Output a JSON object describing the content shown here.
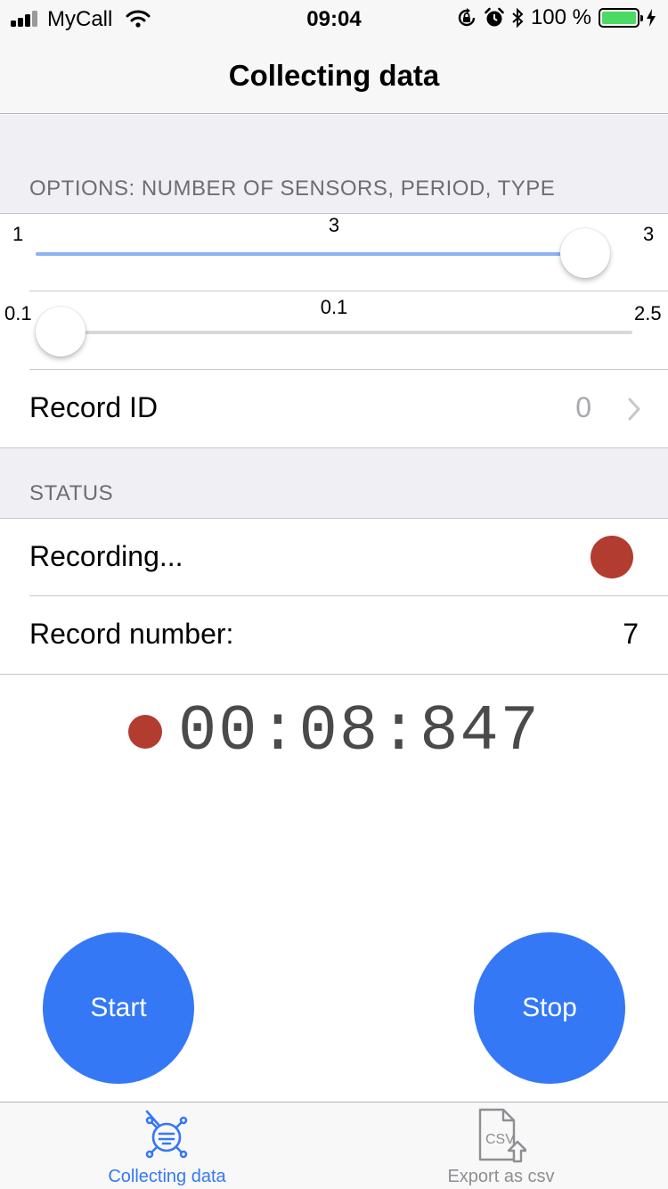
{
  "status_bar": {
    "carrier": "MyCall",
    "time": "09:04",
    "battery_percent": "100 %",
    "battery_level": 1.0,
    "icons": [
      "signal-icon",
      "wifi-icon",
      "orientation-lock-icon",
      "alarm-icon",
      "bluetooth-icon",
      "battery-icon",
      "charging-bolt-icon"
    ]
  },
  "nav": {
    "title": "Collecting data"
  },
  "options": {
    "header": "OPTIONS: NUMBER OF SENSORS, PERIOD, TYPE",
    "sensors_slider": {
      "min": "1",
      "max": "3",
      "value": "3",
      "fraction": 1.0
    },
    "period_slider": {
      "min": "0.1",
      "max": "2.5",
      "value": "0.1",
      "fraction": 0.0
    },
    "record_id": {
      "label": "Record ID",
      "value": "0"
    }
  },
  "status": {
    "header": "STATUS",
    "recording_label": "Recording...",
    "recording_color": "#b23c2f",
    "record_number_label": "Record number:",
    "record_number": "7"
  },
  "timer": {
    "value": "00:08:847"
  },
  "buttons": {
    "start": "Start",
    "stop": "Stop"
  },
  "tab_bar": {
    "tabs": [
      {
        "label": "Collecting data",
        "icon": "sensor-icon",
        "active": true
      },
      {
        "label": "Export as csv",
        "icon": "csv-export-icon",
        "active": false
      }
    ],
    "active_color": "#3478f6",
    "inactive_color": "#8e8e93"
  },
  "colors": {
    "accent": "#3478f6",
    "slider_fill": "#8db3f2",
    "record_red": "#b23c2f"
  }
}
